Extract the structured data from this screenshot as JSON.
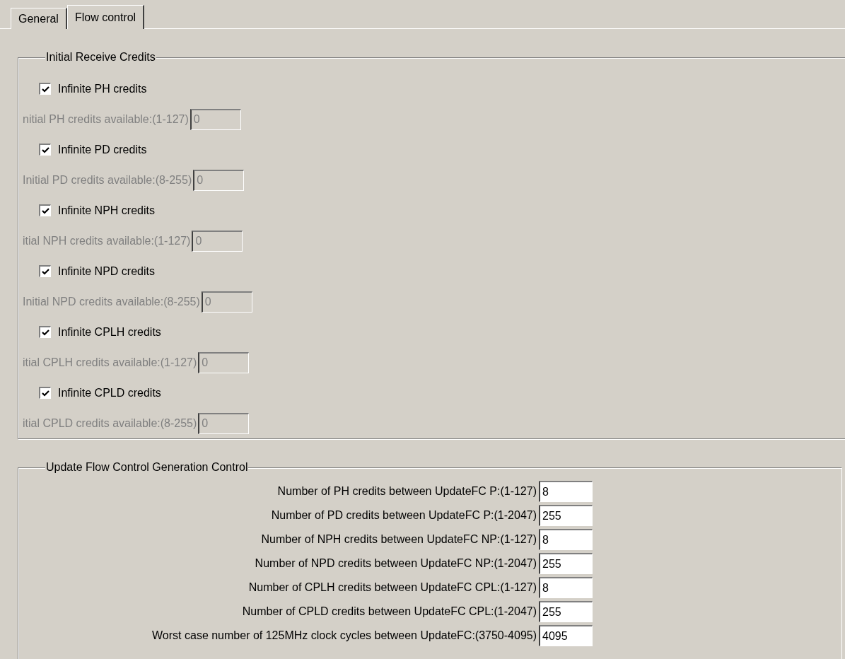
{
  "tabs": [
    {
      "label": "General",
      "selected": false
    },
    {
      "label": "Flow control",
      "selected": true
    }
  ],
  "initial_receive_credits": {
    "title": "Initial Receive Credits",
    "items": [
      {
        "checkbox": "Infinite PH credits",
        "checked": true,
        "label": "nitial PH credits available:(1-127)",
        "value": "0",
        "disabled": true
      },
      {
        "checkbox": "Infinite PD credits",
        "checked": true,
        "label": "Initial PD credits available:(8-255)",
        "value": "0",
        "disabled": true
      },
      {
        "checkbox": "Infinite NPH credits",
        "checked": true,
        "label": "itial NPH credits available:(1-127)",
        "value": "0",
        "disabled": true
      },
      {
        "checkbox": "Infinite NPD credits",
        "checked": true,
        "label": "Initial NPD credits available:(8-255)",
        "value": "0",
        "disabled": true
      },
      {
        "checkbox": "Infinite CPLH credits",
        "checked": true,
        "label": "itial CPLH credits available:(1-127)",
        "value": "0",
        "disabled": true
      },
      {
        "checkbox": "Infinite CPLD credits",
        "checked": true,
        "label": "itial CPLD credits available:(8-255)",
        "value": "0",
        "disabled": true
      }
    ]
  },
  "update_fc": {
    "title": "Update Flow Control Generation Control",
    "fields": [
      {
        "label": "Number of PH credits between UpdateFC P:(1-127)",
        "value": "8"
      },
      {
        "label": "Number of PD credits between UpdateFC P:(1-2047)",
        "value": "255"
      },
      {
        "label": "Number of NPH credits between UpdateFC NP:(1-127)",
        "value": "8"
      },
      {
        "label": "Number of NPD credits between UpdateFC NP:(1-2047)",
        "value": "255"
      },
      {
        "label": "Number of CPLH credits between UpdateFC CPL:(1-127)",
        "value": "8"
      },
      {
        "label": "Number of CPLD credits between UpdateFC CPL:(1-2047)",
        "value": "255"
      },
      {
        "label": "Worst case number of 125MHz clock cycles between UpdateFC:(3750-4095)",
        "value": "4095"
      }
    ]
  }
}
